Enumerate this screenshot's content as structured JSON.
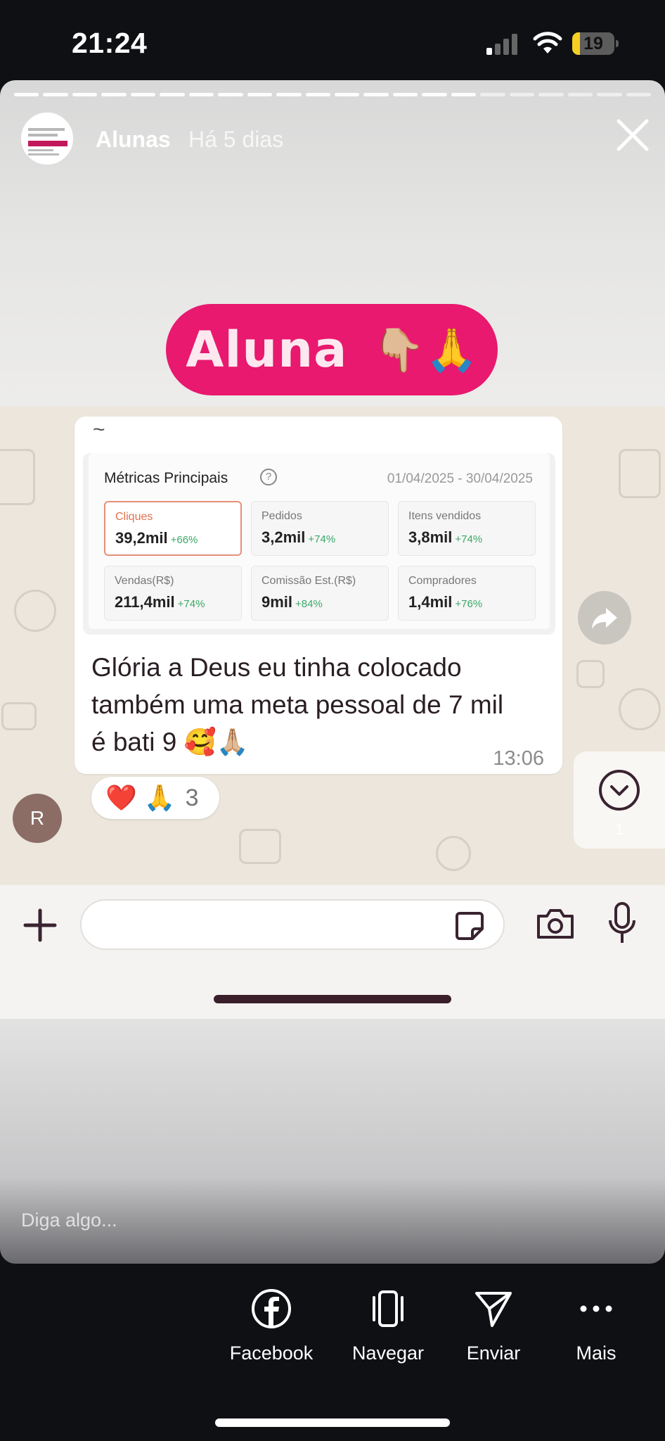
{
  "status_bar": {
    "time": "21:24",
    "battery": "19",
    "battery_level": 0.19
  },
  "story": {
    "username": "Alunas",
    "timestamp": "Há 5 dias",
    "progress_segments": 22,
    "progress_seen": 16,
    "sticker": {
      "text": "Aluna",
      "emoji": "👇🏼🙏"
    }
  },
  "chat": {
    "metrics": {
      "title": "Métricas Principais",
      "date_range": "01/04/2025 - 30/04/2025",
      "cards": [
        {
          "label": "Cliques",
          "value": "39,2mil",
          "change": "+66%",
          "active": true
        },
        {
          "label": "Pedidos",
          "value": "3,2mil",
          "change": "+74%"
        },
        {
          "label": "Itens vendidos",
          "value": "3,8mil",
          "change": "+74%"
        },
        {
          "label": "Vendas(R$)",
          "value": "211,4mil",
          "change": "+74%"
        },
        {
          "label": "Comissão Est.(R$)",
          "value": "9mil",
          "change": "+84%"
        },
        {
          "label": "Compradores",
          "value": "1,4mil",
          "change": "+76%"
        }
      ]
    },
    "sender_prefix": "~",
    "message": "Glória a Deus eu tinha colocado também uma meta pessoal de 7 mil é bati 9 🥰🙏🏼",
    "message_time": "13:06",
    "reactions": {
      "emojis": "❤️ 🙏",
      "count": "3"
    },
    "sender_initial": "R",
    "unread": "1"
  },
  "reply_placeholder": "Diga algo...",
  "actions": [
    {
      "label": "Facebook",
      "icon": "facebook-icon"
    },
    {
      "label": "Navegar",
      "icon": "browse-icon"
    },
    {
      "label": "Enviar",
      "icon": "send-icon"
    },
    {
      "label": "Mais",
      "icon": "more-icon"
    }
  ],
  "colors": {
    "sticker": "#e8196e",
    "percent_green": "#3aa867",
    "active_card": "#e69077"
  }
}
